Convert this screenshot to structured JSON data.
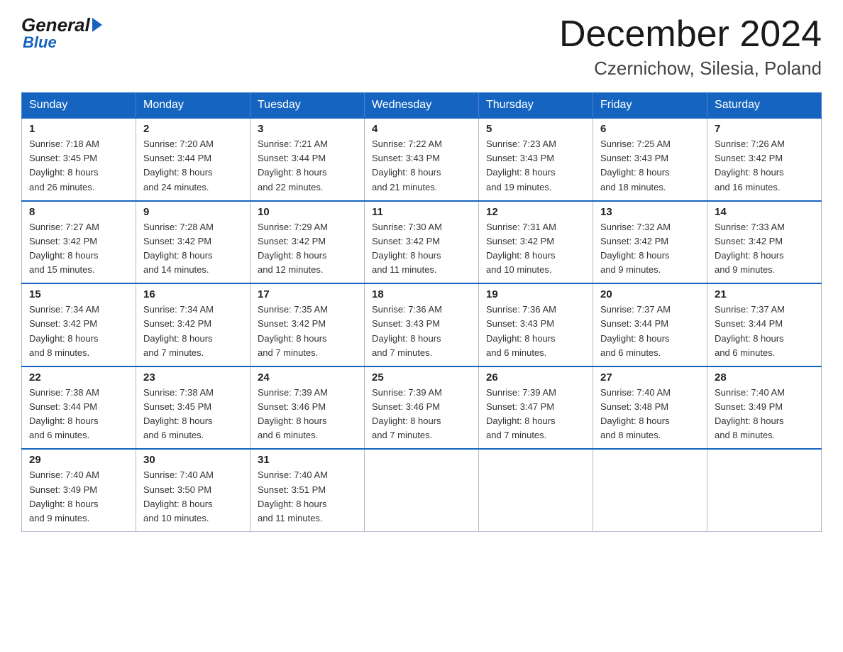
{
  "header": {
    "title": "December 2024",
    "subtitle": "Czernichow, Silesia, Poland",
    "logo_general": "General",
    "logo_blue": "Blue"
  },
  "weekdays": [
    "Sunday",
    "Monday",
    "Tuesday",
    "Wednesday",
    "Thursday",
    "Friday",
    "Saturday"
  ],
  "weeks": [
    [
      {
        "day": "1",
        "sunrise": "7:18 AM",
        "sunset": "3:45 PM",
        "daylight": "8 hours and 26 minutes."
      },
      {
        "day": "2",
        "sunrise": "7:20 AM",
        "sunset": "3:44 PM",
        "daylight": "8 hours and 24 minutes."
      },
      {
        "day": "3",
        "sunrise": "7:21 AM",
        "sunset": "3:44 PM",
        "daylight": "8 hours and 22 minutes."
      },
      {
        "day": "4",
        "sunrise": "7:22 AM",
        "sunset": "3:43 PM",
        "daylight": "8 hours and 21 minutes."
      },
      {
        "day": "5",
        "sunrise": "7:23 AM",
        "sunset": "3:43 PM",
        "daylight": "8 hours and 19 minutes."
      },
      {
        "day": "6",
        "sunrise": "7:25 AM",
        "sunset": "3:43 PM",
        "daylight": "8 hours and 18 minutes."
      },
      {
        "day": "7",
        "sunrise": "7:26 AM",
        "sunset": "3:42 PM",
        "daylight": "8 hours and 16 minutes."
      }
    ],
    [
      {
        "day": "8",
        "sunrise": "7:27 AM",
        "sunset": "3:42 PM",
        "daylight": "8 hours and 15 minutes."
      },
      {
        "day": "9",
        "sunrise": "7:28 AM",
        "sunset": "3:42 PM",
        "daylight": "8 hours and 14 minutes."
      },
      {
        "day": "10",
        "sunrise": "7:29 AM",
        "sunset": "3:42 PM",
        "daylight": "8 hours and 12 minutes."
      },
      {
        "day": "11",
        "sunrise": "7:30 AM",
        "sunset": "3:42 PM",
        "daylight": "8 hours and 11 minutes."
      },
      {
        "day": "12",
        "sunrise": "7:31 AM",
        "sunset": "3:42 PM",
        "daylight": "8 hours and 10 minutes."
      },
      {
        "day": "13",
        "sunrise": "7:32 AM",
        "sunset": "3:42 PM",
        "daylight": "8 hours and 9 minutes."
      },
      {
        "day": "14",
        "sunrise": "7:33 AM",
        "sunset": "3:42 PM",
        "daylight": "8 hours and 9 minutes."
      }
    ],
    [
      {
        "day": "15",
        "sunrise": "7:34 AM",
        "sunset": "3:42 PM",
        "daylight": "8 hours and 8 minutes."
      },
      {
        "day": "16",
        "sunrise": "7:34 AM",
        "sunset": "3:42 PM",
        "daylight": "8 hours and 7 minutes."
      },
      {
        "day": "17",
        "sunrise": "7:35 AM",
        "sunset": "3:42 PM",
        "daylight": "8 hours and 7 minutes."
      },
      {
        "day": "18",
        "sunrise": "7:36 AM",
        "sunset": "3:43 PM",
        "daylight": "8 hours and 7 minutes."
      },
      {
        "day": "19",
        "sunrise": "7:36 AM",
        "sunset": "3:43 PM",
        "daylight": "8 hours and 6 minutes."
      },
      {
        "day": "20",
        "sunrise": "7:37 AM",
        "sunset": "3:44 PM",
        "daylight": "8 hours and 6 minutes."
      },
      {
        "day": "21",
        "sunrise": "7:37 AM",
        "sunset": "3:44 PM",
        "daylight": "8 hours and 6 minutes."
      }
    ],
    [
      {
        "day": "22",
        "sunrise": "7:38 AM",
        "sunset": "3:44 PM",
        "daylight": "8 hours and 6 minutes."
      },
      {
        "day": "23",
        "sunrise": "7:38 AM",
        "sunset": "3:45 PM",
        "daylight": "8 hours and 6 minutes."
      },
      {
        "day": "24",
        "sunrise": "7:39 AM",
        "sunset": "3:46 PM",
        "daylight": "8 hours and 6 minutes."
      },
      {
        "day": "25",
        "sunrise": "7:39 AM",
        "sunset": "3:46 PM",
        "daylight": "8 hours and 7 minutes."
      },
      {
        "day": "26",
        "sunrise": "7:39 AM",
        "sunset": "3:47 PM",
        "daylight": "8 hours and 7 minutes."
      },
      {
        "day": "27",
        "sunrise": "7:40 AM",
        "sunset": "3:48 PM",
        "daylight": "8 hours and 8 minutes."
      },
      {
        "day": "28",
        "sunrise": "7:40 AM",
        "sunset": "3:49 PM",
        "daylight": "8 hours and 8 minutes."
      }
    ],
    [
      {
        "day": "29",
        "sunrise": "7:40 AM",
        "sunset": "3:49 PM",
        "daylight": "8 hours and 9 minutes."
      },
      {
        "day": "30",
        "sunrise": "7:40 AM",
        "sunset": "3:50 PM",
        "daylight": "8 hours and 10 minutes."
      },
      {
        "day": "31",
        "sunrise": "7:40 AM",
        "sunset": "3:51 PM",
        "daylight": "8 hours and 11 minutes."
      },
      null,
      null,
      null,
      null
    ]
  ],
  "labels": {
    "sunrise": "Sunrise:",
    "sunset": "Sunset:",
    "daylight": "Daylight:"
  }
}
